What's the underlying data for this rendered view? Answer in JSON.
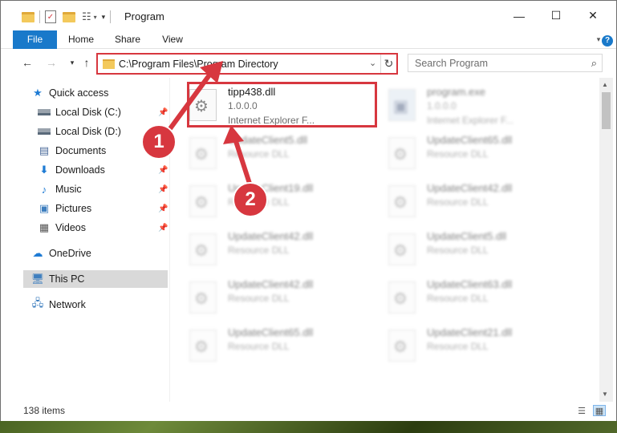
{
  "window": {
    "title": "Program",
    "controls": {
      "minimize": "—",
      "maximize": "☐",
      "close": "✕"
    }
  },
  "ribbon": {
    "tabs": [
      {
        "label": "File"
      },
      {
        "label": "Home"
      },
      {
        "label": "Share"
      },
      {
        "label": "View"
      }
    ]
  },
  "navigation": {
    "back_icon": "arrow-left-icon",
    "forward_icon": "arrow-right-icon",
    "recent_icon": "chevron-down-icon",
    "up_icon": "arrow-up-icon",
    "address": "C:\\Program Files\\Program Directory",
    "search_placeholder": "Search Program"
  },
  "sidebar": {
    "items": [
      {
        "label": "Quick access",
        "icon": "star-icon",
        "pinned": false
      },
      {
        "label": "Local Disk (C:)",
        "icon": "drive-icon",
        "pinned": true
      },
      {
        "label": "Local Disk (D:)",
        "icon": "drive-icon",
        "pinned": false
      },
      {
        "label": "Documents",
        "icon": "document-icon",
        "pinned": true
      },
      {
        "label": "Downloads",
        "icon": "download-icon",
        "pinned": true
      },
      {
        "label": "Music",
        "icon": "music-icon",
        "pinned": true
      },
      {
        "label": "Pictures",
        "icon": "pictures-icon",
        "pinned": true
      },
      {
        "label": "Videos",
        "icon": "videos-icon",
        "pinned": true
      },
      {
        "label": "OneDrive",
        "icon": "cloud-icon",
        "pinned": false
      },
      {
        "label": "This PC",
        "icon": "computer-icon",
        "pinned": false,
        "selected": true
      },
      {
        "label": "Network",
        "icon": "network-icon",
        "pinned": false
      }
    ]
  },
  "files": [
    {
      "name": "tipp438.dll",
      "line2": "1.0.0.0",
      "line3": "Internet Explorer F..."
    },
    {
      "name": "program.exe",
      "line2": "1.0.0.0",
      "line3": "Internet Explorer F..."
    },
    {
      "name": "UpdateClient5.dll",
      "line2": "Resource DLL"
    },
    {
      "name": "UpdateClient65.dll",
      "line2": "Resource DLL"
    },
    {
      "name": "UpdateClient19.dll",
      "line2": "Resource DLL"
    },
    {
      "name": "UpdateClient42.dll",
      "line2": "Resource DLL"
    },
    {
      "name": "UpdateClient42.dll",
      "line2": "Resource DLL"
    },
    {
      "name": "UpdateClient5.dll",
      "line2": "Resource DLL"
    },
    {
      "name": "UpdateClient42.dll",
      "line2": "Resource DLL"
    },
    {
      "name": "UpdateClient63.dll",
      "line2": "Resource DLL"
    },
    {
      "name": "UpdateClient65.dll",
      "line2": "Resource DLL"
    },
    {
      "name": "UpdateClient21.dll",
      "line2": "Resource DLL"
    }
  ],
  "status": {
    "item_count": "138 items"
  },
  "annotations": {
    "marker1": "1",
    "marker2": "2",
    "accent_color": "#d7373f"
  }
}
